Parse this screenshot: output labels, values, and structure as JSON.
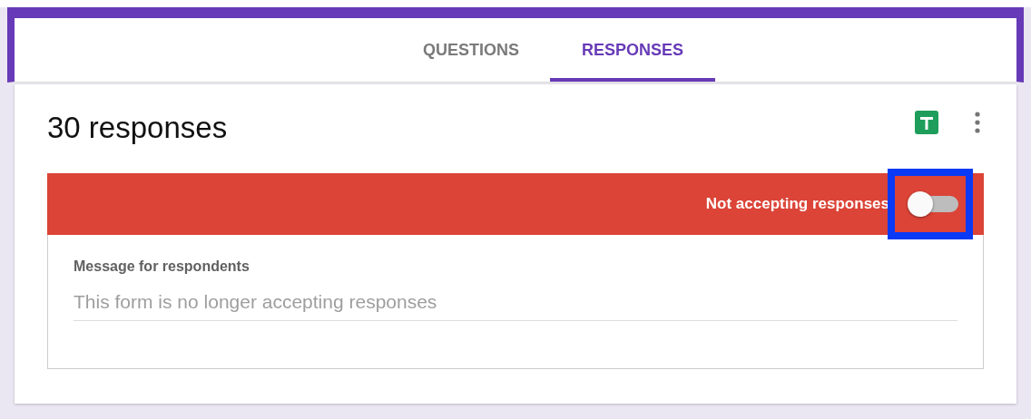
{
  "tabs": [
    {
      "label": "QUESTIONS",
      "selected": false
    },
    {
      "label": "RESPONSES",
      "selected": true
    }
  ],
  "title": "30 responses",
  "accepting_banner": {
    "label": "Not accepting responses",
    "toggle": {
      "on": false,
      "highlighted": true
    }
  },
  "message": {
    "label": "Message for respondents",
    "placeholder": "This form is no longer accepting responses"
  }
}
